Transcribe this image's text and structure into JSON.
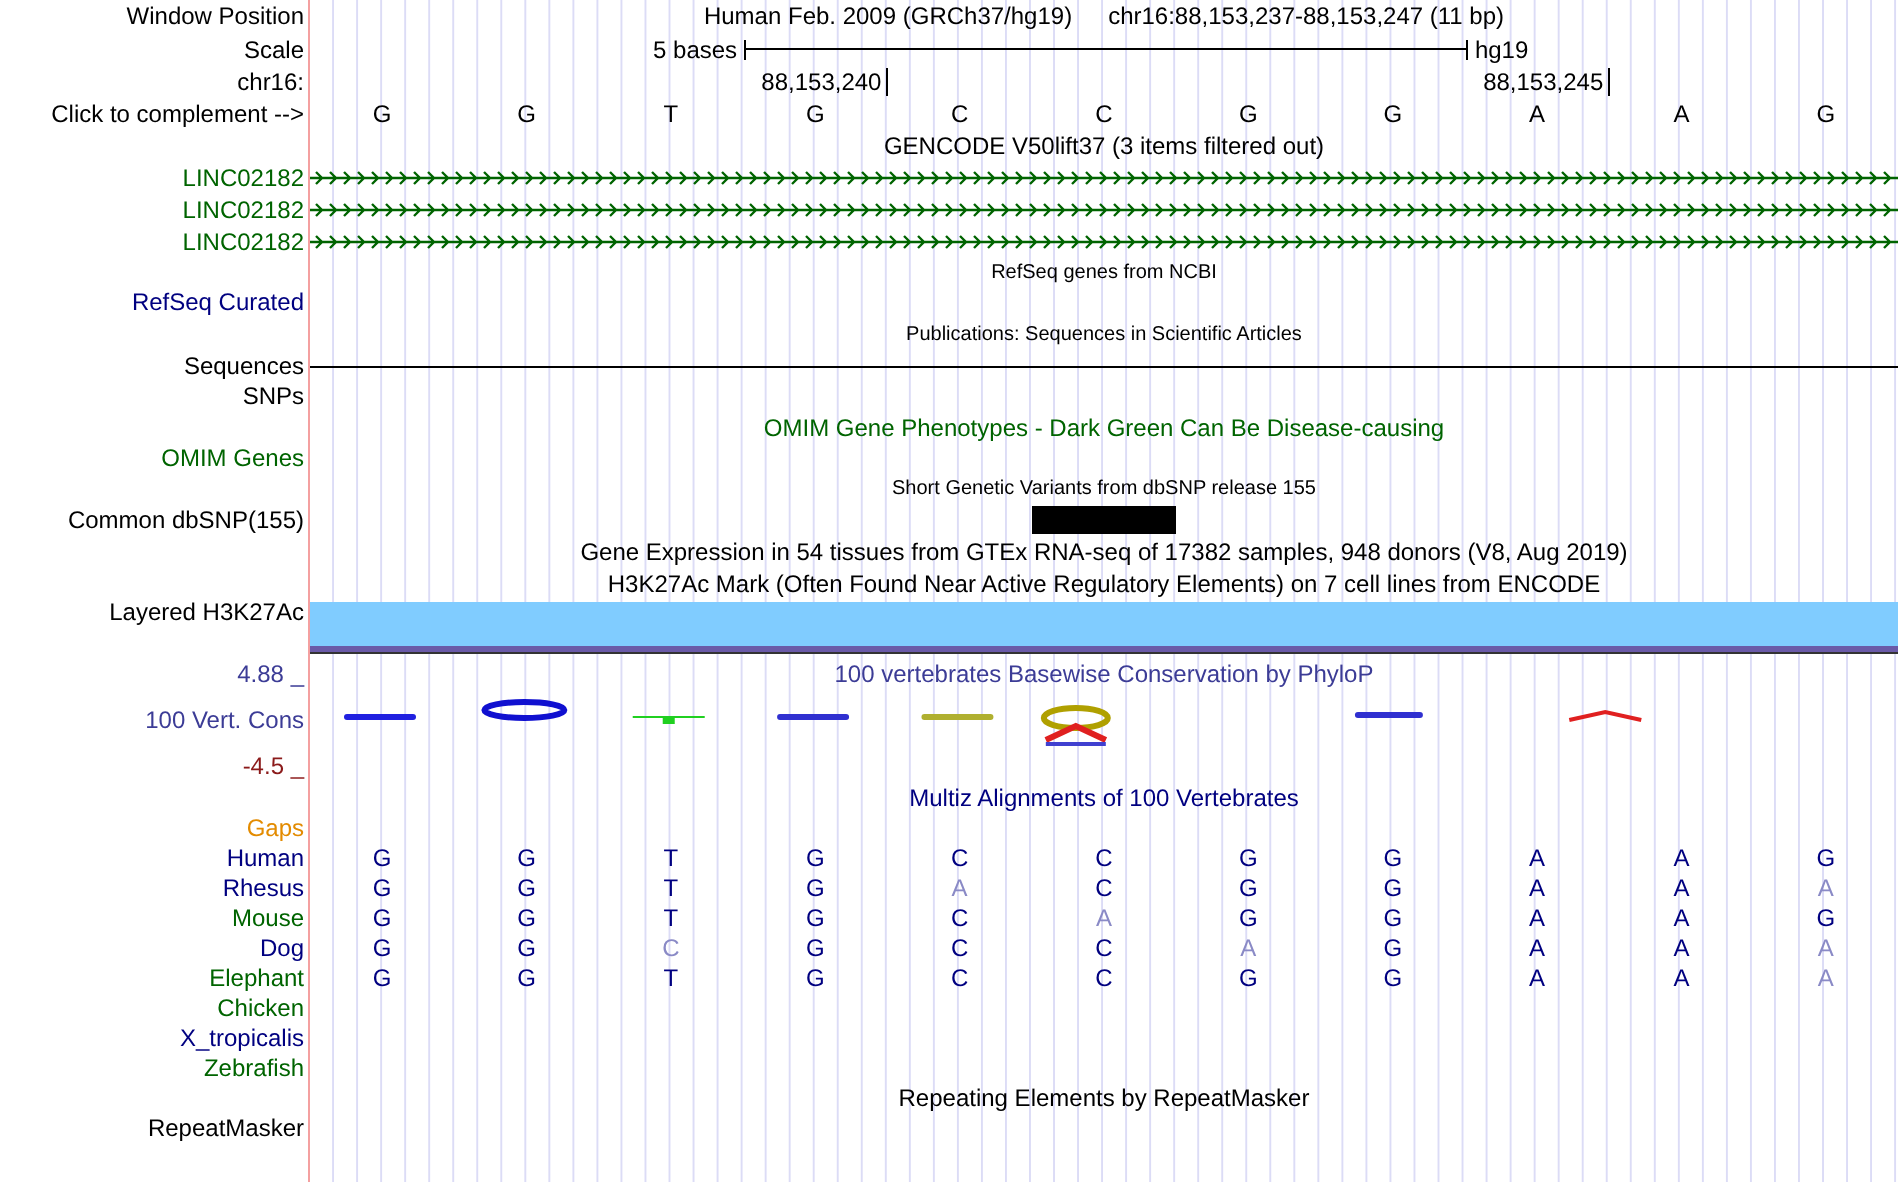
{
  "header": {
    "label": "Window Position",
    "assembly": "Human Feb. 2009 (GRCh37/hg19)",
    "position": "chr16:88,153,237-88,153,247 (11 bp)"
  },
  "scale": {
    "label": "Scale",
    "length": "5 bases",
    "db": "hg19"
  },
  "ruler": {
    "label": "chr16:",
    "ticks": [
      "88,153,240",
      "88,153,245"
    ]
  },
  "sequence": {
    "label": "Click to complement -->",
    "bases": [
      "G",
      "G",
      "T",
      "G",
      "C",
      "C",
      "G",
      "G",
      "A",
      "A",
      "G"
    ]
  },
  "gencode": {
    "title": "GENCODE V50lift37 (3 items filtered out)",
    "genes": [
      "LINC02182",
      "LINC02182",
      "LINC02182"
    ]
  },
  "refseq": {
    "title": "RefSeq genes from NCBI",
    "label": "RefSeq Curated"
  },
  "publications": {
    "title": "Publications: Sequences in Scientific Articles",
    "label": "Sequences"
  },
  "snps": {
    "label": "SNPs"
  },
  "omim": {
    "title": "OMIM Gene Phenotypes - Dark Green Can Be Disease-causing",
    "label": "OMIM Genes"
  },
  "dbsnp": {
    "title": "Short Genetic Variants from dbSNP release 155",
    "label": "Common dbSNP(155)"
  },
  "gtex": {
    "title": "Gene Expression in 54 tissues from GTEx RNA-seq of 17382 samples, 948 donors (V8, Aug 2019)"
  },
  "h3k27ac": {
    "title": "H3K27Ac Mark (Often Found Near Active Regulatory Elements) on 7 cell lines from ENCODE",
    "label": "Layered H3K27Ac"
  },
  "phylop": {
    "title": "100 vertebrates Basewise Conservation by PhyloP",
    "label": "100 Vert. Cons",
    "max": "4.88 _",
    "min": "-4.5 _"
  },
  "multiz": {
    "title": "Multiz Alignments of 100 Vertebrates",
    "gaps_label": "Gaps",
    "species": [
      {
        "name": "Human",
        "color": "#000080",
        "bases": [
          {
            "base": "G",
            "differs": false
          },
          {
            "base": "G",
            "differs": false
          },
          {
            "base": "T",
            "differs": false
          },
          {
            "base": "G",
            "differs": false
          },
          {
            "base": "C",
            "differs": false
          },
          {
            "base": "C",
            "differs": false
          },
          {
            "base": "G",
            "differs": false
          },
          {
            "base": "G",
            "differs": false
          },
          {
            "base": "A",
            "differs": false
          },
          {
            "base": "A",
            "differs": false
          },
          {
            "base": "G",
            "differs": false
          }
        ]
      },
      {
        "name": "Rhesus",
        "color": "#000080",
        "bases": [
          {
            "base": "G",
            "differs": false
          },
          {
            "base": "G",
            "differs": false
          },
          {
            "base": "T",
            "differs": false
          },
          {
            "base": "G",
            "differs": false
          },
          {
            "base": "A",
            "differs": true
          },
          {
            "base": "C",
            "differs": false
          },
          {
            "base": "G",
            "differs": false
          },
          {
            "base": "G",
            "differs": false
          },
          {
            "base": "A",
            "differs": false
          },
          {
            "base": "A",
            "differs": false
          },
          {
            "base": "A",
            "differs": true
          }
        ]
      },
      {
        "name": "Mouse",
        "color": "#006400",
        "bases": [
          {
            "base": "G",
            "differs": false
          },
          {
            "base": "G",
            "differs": false
          },
          {
            "base": "T",
            "differs": false
          },
          {
            "base": "G",
            "differs": false
          },
          {
            "base": "C",
            "differs": false
          },
          {
            "base": "A",
            "differs": true
          },
          {
            "base": "G",
            "differs": false
          },
          {
            "base": "G",
            "differs": false
          },
          {
            "base": "A",
            "differs": false
          },
          {
            "base": "A",
            "differs": false
          },
          {
            "base": "G",
            "differs": false
          }
        ]
      },
      {
        "name": "Dog",
        "color": "#000080",
        "bases": [
          {
            "base": "G",
            "differs": false
          },
          {
            "base": "G",
            "differs": false
          },
          {
            "base": "C",
            "differs": true
          },
          {
            "base": "G",
            "differs": false
          },
          {
            "base": "C",
            "differs": false
          },
          {
            "base": "C",
            "differs": false
          },
          {
            "base": "A",
            "differs": true
          },
          {
            "base": "G",
            "differs": false
          },
          {
            "base": "A",
            "differs": false
          },
          {
            "base": "A",
            "differs": false
          },
          {
            "base": "A",
            "differs": true
          }
        ]
      },
      {
        "name": "Elephant",
        "color": "#006400",
        "bases": [
          {
            "base": "G",
            "differs": false
          },
          {
            "base": "G",
            "differs": false
          },
          {
            "base": "T",
            "differs": false
          },
          {
            "base": "G",
            "differs": false
          },
          {
            "base": "C",
            "differs": false
          },
          {
            "base": "C",
            "differs": false
          },
          {
            "base": "G",
            "differs": false
          },
          {
            "base": "G",
            "differs": false
          },
          {
            "base": "A",
            "differs": false
          },
          {
            "base": "A",
            "differs": false
          },
          {
            "base": "A",
            "differs": true
          }
        ]
      },
      {
        "name": "Chicken",
        "color": "#006400"
      },
      {
        "name": "X_tropicalis",
        "color": "#000080"
      },
      {
        "name": "Zebrafish",
        "color": "#006400"
      }
    ]
  },
  "repeatmasker": {
    "title": "Repeating Elements by RepeatMasker",
    "label": "RepeatMasker"
  }
}
